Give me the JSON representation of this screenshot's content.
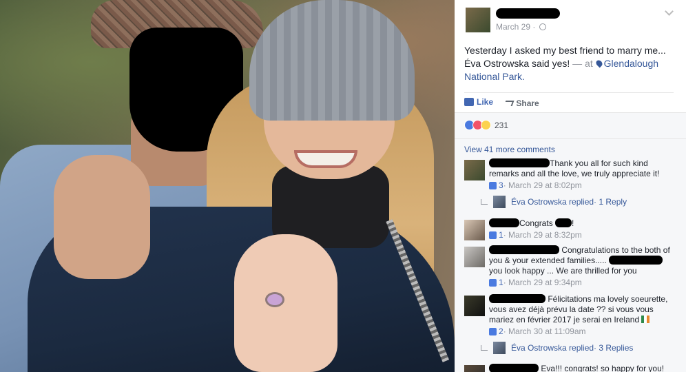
{
  "post": {
    "date": "March 29 ·",
    "text_main": "Yesterday I asked my best friend to marry me... Éva Ostrowska said yes!",
    "text_sep": " — at ",
    "location": "Glendalough National Park."
  },
  "actions": {
    "like_label": "Like",
    "share_label": "Share"
  },
  "reactions": {
    "count": "231"
  },
  "view_more": "View 41 more comments",
  "comments": [
    {
      "text": "Thank you all for such kind remarks and all the love, we truly appreciate it!",
      "likes": "3",
      "time": " · March 29 at 8:02pm",
      "reply_name": "Éva Ostrowska replied",
      "reply_count": " · 1 Reply"
    },
    {
      "text_a": "Congrats",
      "text_b": "!",
      "likes": "1",
      "time": " · March 29 at 8:32pm"
    },
    {
      "text_a": "Congratulations to the both of you & your extended families.....",
      "text_b": "you look happy ... We are thrilled for you",
      "likes": "1",
      "time": " · March 29 at 9:34pm"
    },
    {
      "text": "Félicitations ma lovely soeurette, vous avez déjà prévu la date ?? si vous vous mariez en février 2017 je serai en Ireland",
      "likes": "2",
      "time": " · March 30 at 11:09am",
      "reply_name": "Éva Ostrowska replied",
      "reply_count": " · 3 Replies"
    },
    {
      "text": "Eva!!! congrats! so happy for you!(\".)"
    }
  ],
  "colors": {
    "link_blue": "#365899",
    "like_blue": "#4267b2",
    "muted": "#90949c",
    "comment_bg": "#f6f7f9"
  },
  "icons": [
    "globe-icon",
    "chevron-down-icon",
    "location-pin-icon",
    "thumbs-up-icon",
    "share-arrow-icon",
    "like-reaction-icon",
    "love-reaction-icon",
    "wow-reaction-icon",
    "reply-arrow-icon",
    "flag-icon"
  ]
}
